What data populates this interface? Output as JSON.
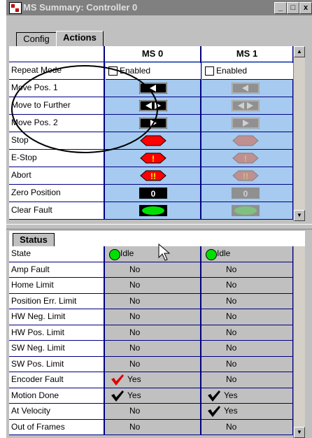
{
  "window": {
    "title": "MS Summary: Controller 0",
    "buttons": {
      "minimize": "_",
      "maximize": "□",
      "close": "x"
    }
  },
  "tabs": [
    {
      "label": "Config"
    },
    {
      "label": "Actions"
    }
  ],
  "actions_table": {
    "columns": [
      "MS 0",
      "MS 1"
    ],
    "rows": [
      {
        "label": "Repeat Mode",
        "ms0": "Enabled",
        "ms1": "Enabled"
      },
      {
        "label": "Move Pos. 1"
      },
      {
        "label": "Move to Further"
      },
      {
        "label": "Move Pos. 2"
      },
      {
        "label": "Stop"
      },
      {
        "label": "E-Stop"
      },
      {
        "label": "Abort"
      },
      {
        "label": "Zero Position"
      },
      {
        "label": "Clear Fault"
      }
    ],
    "ms1_controls_enabled": false
  },
  "status_section": {
    "header": "Status",
    "rows": [
      {
        "label": "State",
        "ms0": "Idle",
        "ms1": "Idle"
      },
      {
        "label": "Amp Fault",
        "ms0": "No",
        "ms1": "No"
      },
      {
        "label": "Home Limit",
        "ms0": "No",
        "ms1": "No"
      },
      {
        "label": "Position Err. Limit",
        "ms0": "No",
        "ms1": "No"
      },
      {
        "label": "HW Neg. Limit",
        "ms0": "No",
        "ms1": "No"
      },
      {
        "label": "HW Pos. Limit",
        "ms0": "No",
        "ms1": "No"
      },
      {
        "label": "SW Neg. Limit",
        "ms0": "No",
        "ms1": "No"
      },
      {
        "label": "SW Pos. Limit",
        "ms0": "No",
        "ms1": "No"
      },
      {
        "label": "Encoder Fault",
        "ms0": "Yes",
        "ms1": "No"
      },
      {
        "label": "Motion Done",
        "ms0": "Yes",
        "ms1": "Yes"
      },
      {
        "label": "At Velocity",
        "ms0": "No",
        "ms1": "Yes"
      },
      {
        "label": "Out of Frames",
        "ms0": "No",
        "ms1": "No"
      }
    ]
  },
  "colors": {
    "grid_line": "#000080",
    "actions_bg": "#a6caf0",
    "status_bg": "#c0c0c0",
    "idle_dot": "#00e000",
    "encoder_check": "#e00000"
  }
}
